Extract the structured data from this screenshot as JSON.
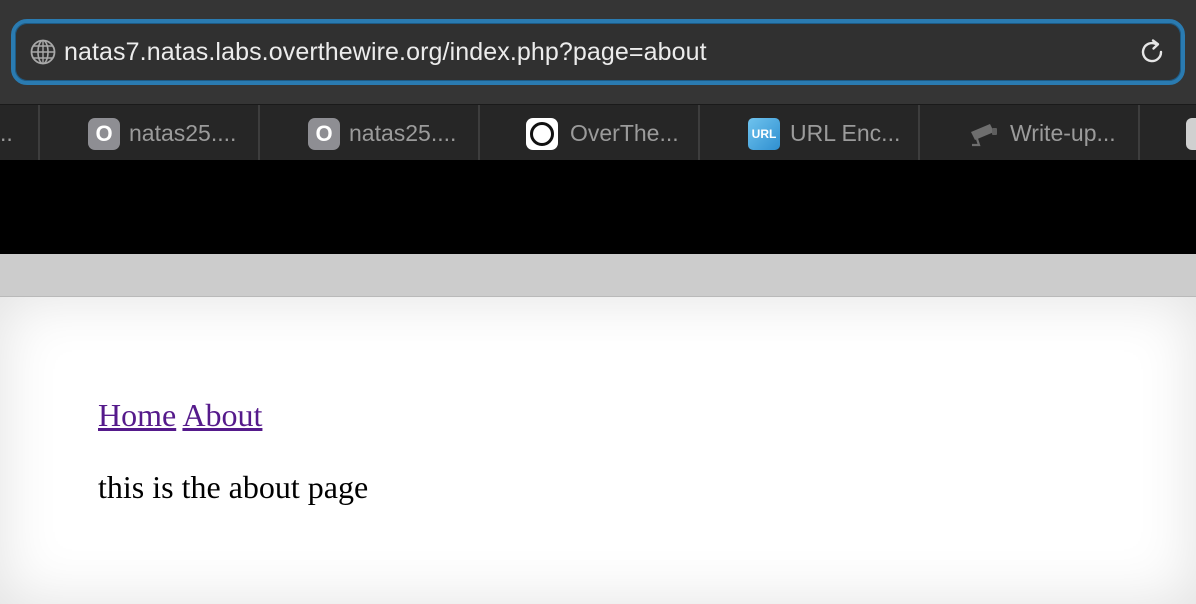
{
  "browser": {
    "url": "natas7.natas.labs.overthewire.org/index.php?page=about",
    "tabs": [
      {
        "title": "..",
        "favicon": "none",
        "partial": "left"
      },
      {
        "title": "natas25....",
        "favicon": "letter-o-icon"
      },
      {
        "title": "natas25....",
        "favicon": "letter-o-icon"
      },
      {
        "title": "OverThe...",
        "favicon": "overthewire-ring-icon"
      },
      {
        "title": "URL Enc...",
        "favicon": "url-badge-icon"
      },
      {
        "title": "Write-up...",
        "favicon": "security-camera-icon"
      },
      {
        "title": "",
        "favicon": "page-icon",
        "partial": "right"
      }
    ],
    "colors": {
      "accent": "#2a7bb1",
      "toolbar": "#353535",
      "tabstrip": "#262626"
    }
  },
  "page": {
    "nav": {
      "home_label": "Home",
      "about_label": "About"
    },
    "content_text": "this is the about page",
    "colors": {
      "link": "#551a8b",
      "header": "#000000",
      "band": "#cccccc"
    }
  },
  "icons": {
    "favicon_o_letter": "O",
    "favicon_url_label": "URL"
  }
}
